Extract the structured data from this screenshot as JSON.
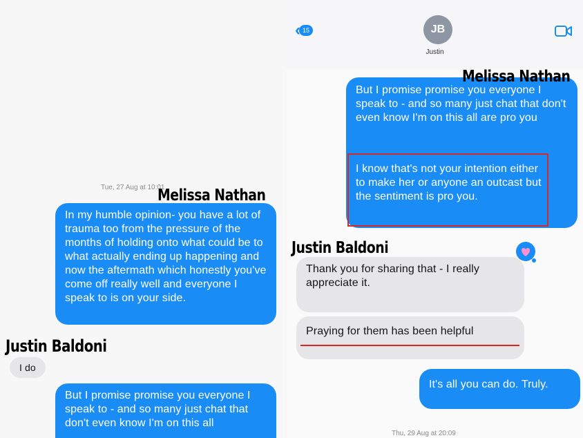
{
  "header": {
    "back_count": "15",
    "avatar_initials": "JB",
    "contact_name": "Justin"
  },
  "labels": {
    "melissa_nathan": "Melissa Nathan",
    "justin_baldoni": "Justin Baldoni"
  },
  "left": {
    "timestamp": "Tue, 27 Aug at 10:01",
    "messages": [
      "In my humble opinion- you have a lot of trauma too from the pressure of the months of holding onto what could be to what actually ending up happening and now the aftermath which honestly you've come off really well and everyone I speak to is on your side.",
      "I do",
      "But I promise promise you everyone I speak to - and so many just chat that don't even know I'm on this all"
    ]
  },
  "right": {
    "messages": [
      "But I promise promise you everyone I speak to - and so many just chat that don't even know I'm on this all are pro you",
      "I know that's not your intention either to make her or anyone an outcast but the sentiment is pro you.",
      "Thank you for sharing that - I really appreciate it.",
      "Praying for them has been helpful",
      "It's all you can do. Truly."
    ],
    "timestamp": "Thu, 29 Aug at 20:09"
  },
  "colors": {
    "bubble_blue": "#1a8cf5",
    "bubble_gray": "#e6e6e8",
    "highlight_red": "#d42a2a"
  },
  "icons": [
    "chevron-left-icon",
    "video-camera-icon",
    "heart-tapback-icon"
  ]
}
